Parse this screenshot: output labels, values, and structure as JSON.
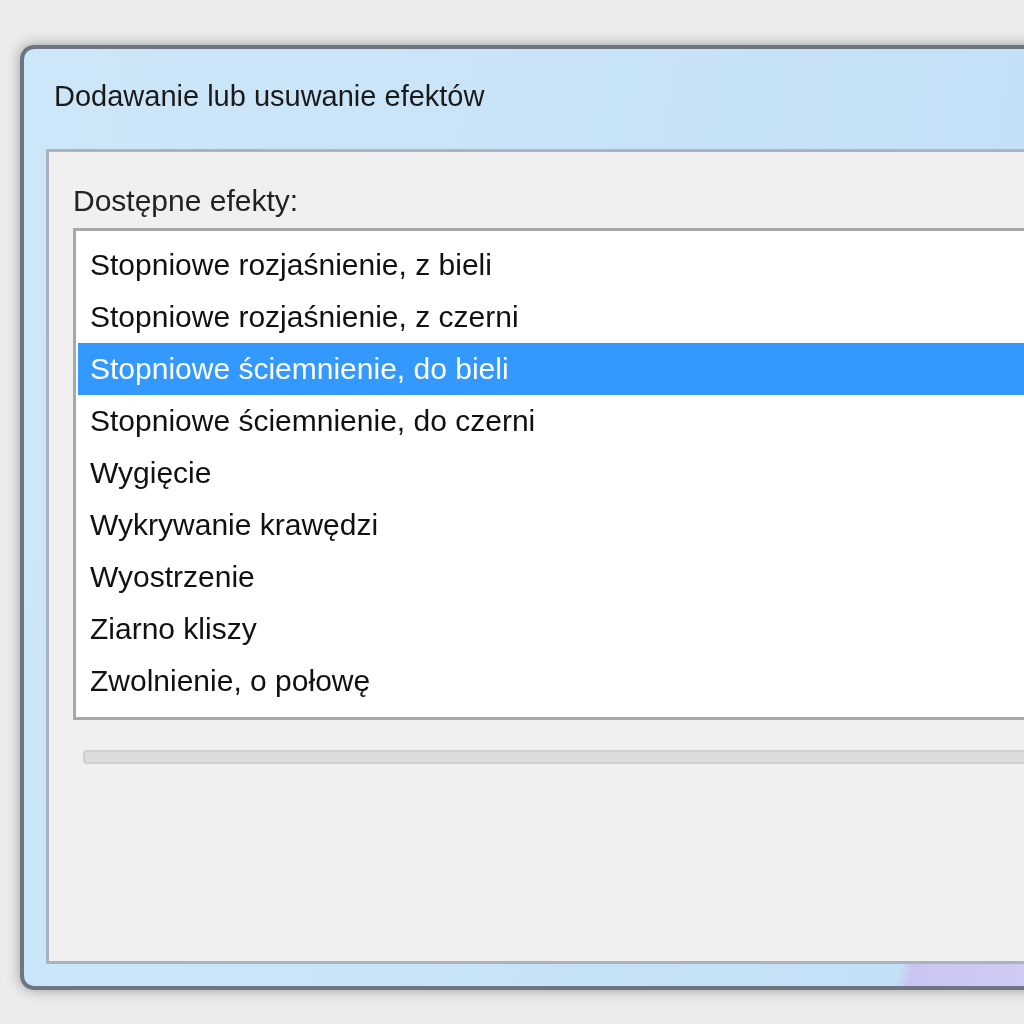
{
  "window": {
    "title": "Dodawanie lub usuwanie efektów"
  },
  "effects": {
    "label": "Dostępne efekty:",
    "items": [
      {
        "label": "Stopniowe rozjaśnienie, z bieli",
        "selected": false
      },
      {
        "label": "Stopniowe rozjaśnienie, z czerni",
        "selected": false
      },
      {
        "label": "Stopniowe ściemnienie, do bieli",
        "selected": true
      },
      {
        "label": "Stopniowe ściemnienie, do czerni",
        "selected": false
      },
      {
        "label": "Wygięcie",
        "selected": false
      },
      {
        "label": "Wykrywanie krawędzi",
        "selected": false
      },
      {
        "label": "Wyostrzenie",
        "selected": false
      },
      {
        "label": "Ziarno kliszy",
        "selected": false
      },
      {
        "label": "Zwolnienie, o połowę",
        "selected": false
      }
    ]
  }
}
